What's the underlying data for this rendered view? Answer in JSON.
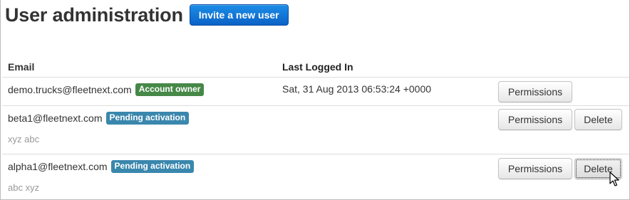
{
  "page": {
    "title": "User administration",
    "invite_button": "Invite a new user"
  },
  "table": {
    "columns": [
      "Email",
      "Last Logged In"
    ],
    "rows": [
      {
        "email": "demo.trucks@fleetnext.com",
        "badge": "Account owner",
        "badge_color": "#468847",
        "note": "",
        "last_logged_in": "Sat, 31 Aug 2013 06:53:24 +0000",
        "permissions_label": "Permissions"
      },
      {
        "email": "beta1@fleetnext.com",
        "badge": "Pending activation",
        "badge_color": "#3a87ad",
        "note": "xyz abc",
        "last_logged_in": "",
        "permissions_label": "Permissions",
        "delete_label": "Delete"
      },
      {
        "email": "alpha1@fleetnext.com",
        "badge": "Pending activation",
        "badge_color": "#3a87ad",
        "note": "abc xyz",
        "last_logged_in": "",
        "permissions_label": "Permissions",
        "delete_label": "Delete"
      }
    ]
  },
  "icons": {
    "cursor": "mouse-pointer-icon"
  },
  "colors": {
    "primary_button": "#0b62c6",
    "account_owner_badge": "#468847",
    "pending_badge": "#3a87ad"
  }
}
